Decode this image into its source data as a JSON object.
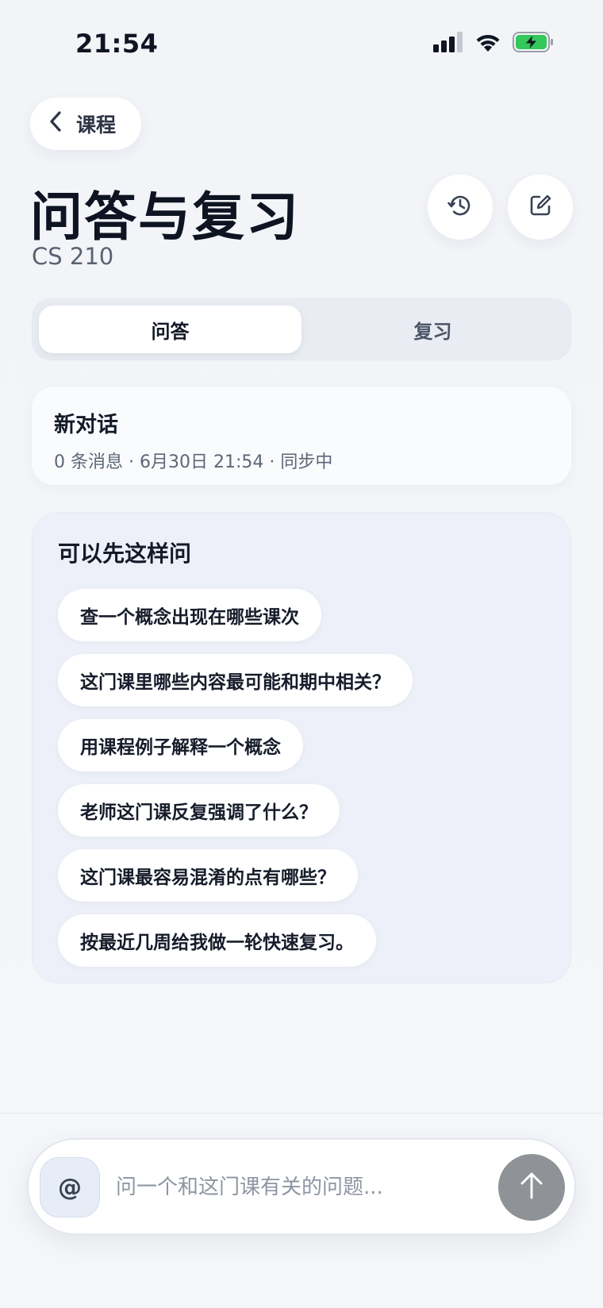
{
  "status_bar": {
    "time": "21:54",
    "icons": [
      "cellular-signal-icon",
      "wifi-icon",
      "battery-charging-icon"
    ],
    "battery_color": "#34c759"
  },
  "header": {
    "back_label": "课程",
    "title": "问答与复习",
    "course_code": "CS 210",
    "actions": [
      "history-icon",
      "compose-icon"
    ]
  },
  "tabs": [
    {
      "label": "问答",
      "active": true
    },
    {
      "label": "复习",
      "active": false
    }
  ],
  "conversation": {
    "title": "新对话",
    "meta": "0 条消息 · 6月30日 21:54 · 同步中"
  },
  "suggestions": {
    "title": "可以先这样问",
    "items": [
      "查一个概念出现在哪些课次",
      "这门课里哪些内容最可能和期中相关？",
      "用课程例子解释一个概念",
      "老师这门课反复强调了什么？",
      "这门课最容易混淆的点有哪些？",
      "按最近几周给我做一轮快速复习。"
    ]
  },
  "composer": {
    "mention_label": "@",
    "placeholder": "问一个和这门课有关的问题...",
    "send_icon": "arrow-up-icon",
    "send_color": "#8f9296"
  }
}
